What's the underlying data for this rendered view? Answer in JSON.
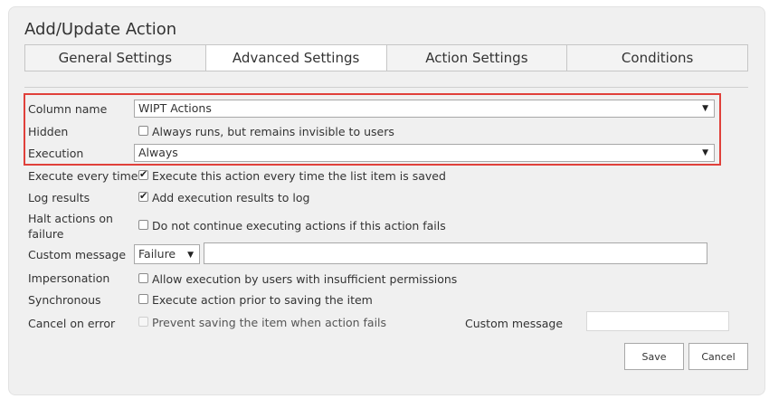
{
  "dialog": {
    "title": "Add/Update Action"
  },
  "tabs": [
    {
      "label": "General Settings",
      "active": false
    },
    {
      "label": "Advanced Settings",
      "active": true
    },
    {
      "label": "Action Settings",
      "active": false
    },
    {
      "label": "Conditions",
      "active": false
    }
  ],
  "form": {
    "column_name": {
      "label": "Column name",
      "value": "WIPT Actions"
    },
    "hidden": {
      "label": "Hidden",
      "option": "Always runs, but remains invisible to users",
      "checked": false
    },
    "execution": {
      "label": "Execution",
      "value": "Always"
    },
    "execute_every_time": {
      "label": "Execute every time",
      "option": "Execute this action every time the list item is saved",
      "checked": true
    },
    "log_results": {
      "label": "Log results",
      "option": "Add execution results to log",
      "checked": true
    },
    "halt_actions": {
      "label_line1": "Halt actions on",
      "label_line2": "failure",
      "option": "Do not continue executing actions if this action fails",
      "checked": false
    },
    "custom_message": {
      "label": "Custom message",
      "type_value": "Failure",
      "text_value": ""
    },
    "impersonation": {
      "label": "Impersonation",
      "option": "Allow execution by users with insufficient permissions",
      "checked": false
    },
    "synchronous": {
      "label": "Synchronous",
      "option": "Execute action prior to saving the item",
      "checked": false
    },
    "cancel_on_error": {
      "label": "Cancel on error",
      "option": "Prevent saving the item when action fails",
      "checked": false,
      "disabled": true,
      "custom_message_label": "Custom message",
      "custom_message_value": ""
    }
  },
  "buttons": {
    "save": "Save",
    "cancel": "Cancel"
  },
  "colors": {
    "highlight": "#e0403a",
    "panel_bg": "#f0f0f0"
  }
}
